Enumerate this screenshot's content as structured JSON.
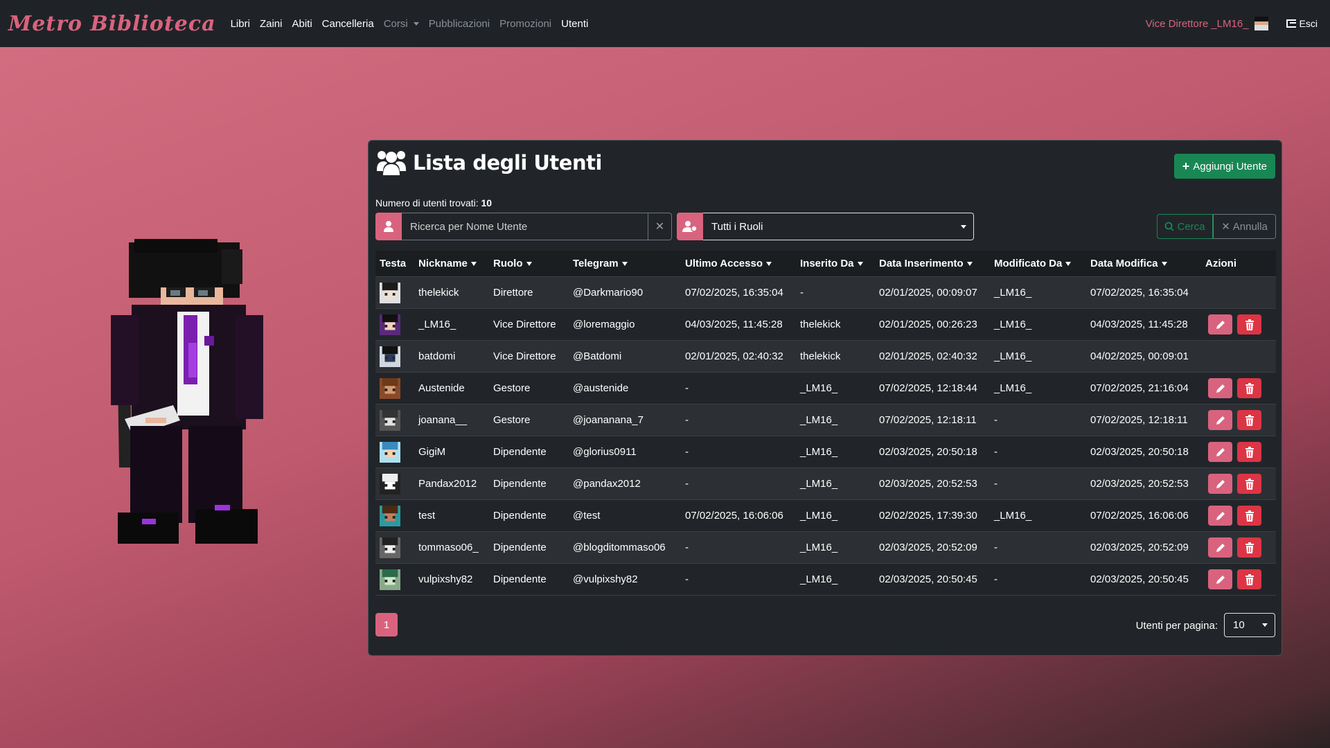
{
  "navbar": {
    "brand": "Metro Biblioteca",
    "items": [
      {
        "label": "Libri"
      },
      {
        "label": "Zaini"
      },
      {
        "label": "Abiti"
      },
      {
        "label": "Cancelleria"
      },
      {
        "label": "Corsi"
      },
      {
        "label": "Pubblicazioni"
      },
      {
        "label": "Promozioni"
      },
      {
        "label": "Utenti"
      }
    ],
    "user": "Vice Direttore _LM16_",
    "logout": "Esci"
  },
  "card": {
    "title": "Lista degli Utenti",
    "add_button": "Aggiungi Utente",
    "count_label": "Numero di utenti trovati:",
    "count_value": "10",
    "search_placeholder": "Ricerca per Nome Utente",
    "role_filter": "Tutti i Ruoli",
    "search_button": "Cerca",
    "cancel_button": "Annulla"
  },
  "table": {
    "headers": [
      "Testa",
      "Nickname",
      "Ruolo",
      "Telegram",
      "Ultimo Accesso",
      "Inserito Da",
      "Data Inserimento",
      "Modificato Da",
      "Data Modifica",
      "Azioni"
    ],
    "rows": [
      {
        "nickname": "thelekick",
        "role": "Direttore",
        "telegram": "@Darkmario90",
        "last_access": "07/02/2025, 16:35:04",
        "inserted_by": "-",
        "inserted_at": "02/01/2025, 00:09:07",
        "modified_by": "_LM16_",
        "modified_at": "07/02/2025, 16:35:04"
      },
      {
        "nickname": "_LM16_",
        "role": "Vice Direttore",
        "telegram": "@loremaggio",
        "last_access": "04/03/2025, 11:45:28",
        "inserted_by": "thelekick",
        "inserted_at": "02/01/2025, 00:26:23",
        "modified_by": "_LM16_",
        "modified_at": "04/03/2025, 11:45:28"
      },
      {
        "nickname": "batdomi",
        "role": "Vice Direttore",
        "telegram": "@Batdomi",
        "last_access": "02/01/2025, 02:40:32",
        "inserted_by": "thelekick",
        "inserted_at": "02/01/2025, 02:40:32",
        "modified_by": "_LM16_",
        "modified_at": "04/02/2025, 00:09:01"
      },
      {
        "nickname": "Austenide",
        "role": "Gestore",
        "telegram": "@austenide",
        "last_access": "-",
        "inserted_by": "_LM16_",
        "inserted_at": "07/02/2025, 12:18:44",
        "modified_by": "_LM16_",
        "modified_at": "07/02/2025, 21:16:04"
      },
      {
        "nickname": "joanana__",
        "role": "Gestore",
        "telegram": "@joananana_7",
        "last_access": "-",
        "inserted_by": "_LM16_",
        "inserted_at": "07/02/2025, 12:18:11",
        "modified_by": "-",
        "modified_at": "07/02/2025, 12:18:11"
      },
      {
        "nickname": "GigiM",
        "role": "Dipendente",
        "telegram": "@glorius0911",
        "last_access": "-",
        "inserted_by": "_LM16_",
        "inserted_at": "02/03/2025, 20:50:18",
        "modified_by": "-",
        "modified_at": "02/03/2025, 20:50:18"
      },
      {
        "nickname": "Pandax2012",
        "role": "Dipendente",
        "telegram": "@pandax2012",
        "last_access": "-",
        "inserted_by": "_LM16_",
        "inserted_at": "02/03/2025, 20:52:53",
        "modified_by": "-",
        "modified_at": "02/03/2025, 20:52:53"
      },
      {
        "nickname": "test",
        "role": "Dipendente",
        "telegram": "@test",
        "last_access": "07/02/2025, 16:06:06",
        "inserted_by": "_LM16_",
        "inserted_at": "02/02/2025, 17:39:30",
        "modified_by": "_LM16_",
        "modified_at": "07/02/2025, 16:06:06"
      },
      {
        "nickname": "tommaso06_",
        "role": "Dipendente",
        "telegram": "@blogditommaso06",
        "last_access": "-",
        "inserted_by": "_LM16_",
        "inserted_at": "02/03/2025, 20:52:09",
        "modified_by": "-",
        "modified_at": "02/03/2025, 20:52:09"
      },
      {
        "nickname": "vulpixshy82",
        "role": "Dipendente",
        "telegram": "@vulpixshy82",
        "last_access": "-",
        "inserted_by": "_LM16_",
        "inserted_at": "02/03/2025, 20:50:45",
        "modified_by": "-",
        "modified_at": "02/03/2025, 20:50:45"
      }
    ]
  },
  "pagination": {
    "current_page": "1",
    "per_page_label": "Utenti per pagina:",
    "per_page_value": "10"
  },
  "colors": {
    "brand": "#d9637e",
    "navbar": "#1f2327",
    "card": "#212529",
    "success": "#198754",
    "danger": "#dc3545"
  }
}
